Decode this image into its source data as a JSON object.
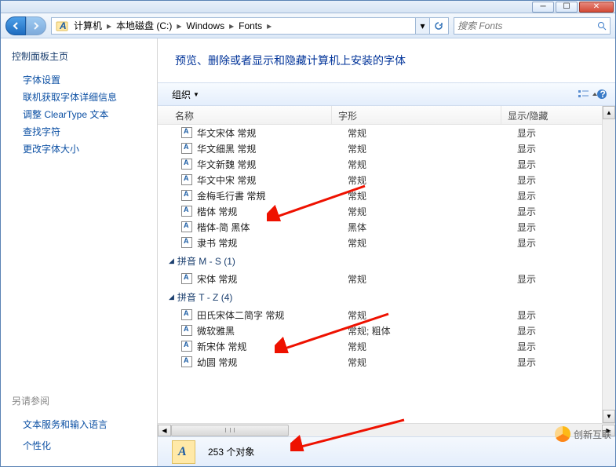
{
  "titlebar": {},
  "breadcrumb": {
    "items": [
      "计算机",
      "本地磁盘 (C:)",
      "Windows",
      "Fonts"
    ]
  },
  "search": {
    "placeholder": "搜索 Fonts"
  },
  "sidebar": {
    "title": "控制面板主页",
    "links": [
      "字体设置",
      "联机获取字体详细信息",
      "调整 ClearType 文本",
      "查找字符",
      "更改字体大小"
    ],
    "see_also": "另请参阅",
    "footer": [
      "文本服务和输入语言",
      "个性化"
    ]
  },
  "main": {
    "heading": "预览、删除或者显示和隐藏计算机上安装的字体"
  },
  "toolbar": {
    "organize": "组织"
  },
  "columns": {
    "name": "名称",
    "style": "字形",
    "show": "显示/隐藏"
  },
  "fonts": [
    {
      "name": "华文宋体 常规",
      "style": "常规",
      "show": "显示"
    },
    {
      "name": "华文细黑 常规",
      "style": "常规",
      "show": "显示"
    },
    {
      "name": "华文新魏 常规",
      "style": "常规",
      "show": "显示"
    },
    {
      "name": "华文中宋 常规",
      "style": "常规",
      "show": "显示"
    },
    {
      "name": "金梅毛行書 常規",
      "style": "常规",
      "show": "显示"
    },
    {
      "name": "楷体 常规",
      "style": "常规",
      "show": "显示"
    },
    {
      "name": "楷体-简 黑体",
      "style": "黑体",
      "show": "显示"
    },
    {
      "name": "隶书 常规",
      "style": "常规",
      "show": "显示"
    }
  ],
  "group_ms": {
    "label": "拼音 M - S (1)"
  },
  "fonts_ms": [
    {
      "name": "宋体 常规",
      "style": "常规",
      "show": "显示"
    }
  ],
  "group_tz": {
    "label": "拼音 T - Z (4)"
  },
  "fonts_tz": [
    {
      "name": "田氏宋体二简字 常规",
      "style": "常规",
      "show": "显示"
    },
    {
      "name": "微软雅黑",
      "style": "常规; 粗体",
      "show": "显示"
    },
    {
      "name": "新宋体 常规",
      "style": "常规",
      "show": "显示"
    },
    {
      "name": "幼圆 常规",
      "style": "常规",
      "show": "显示"
    }
  ],
  "status": {
    "count": "253 个对象"
  },
  "watermark": "创新互联"
}
